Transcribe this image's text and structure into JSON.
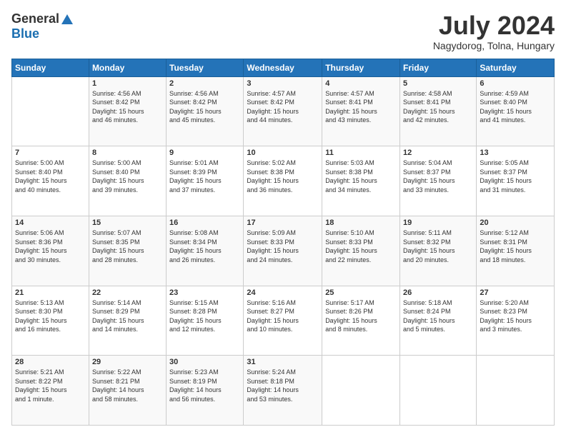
{
  "logo": {
    "general": "General",
    "blue": "Blue"
  },
  "header": {
    "month": "July 2024",
    "location": "Nagydorog, Tolna, Hungary"
  },
  "weekdays": [
    "Sunday",
    "Monday",
    "Tuesday",
    "Wednesday",
    "Thursday",
    "Friday",
    "Saturday"
  ],
  "weeks": [
    [
      {
        "day": "",
        "info": ""
      },
      {
        "day": "1",
        "info": "Sunrise: 4:56 AM\nSunset: 8:42 PM\nDaylight: 15 hours\nand 46 minutes."
      },
      {
        "day": "2",
        "info": "Sunrise: 4:56 AM\nSunset: 8:42 PM\nDaylight: 15 hours\nand 45 minutes."
      },
      {
        "day": "3",
        "info": "Sunrise: 4:57 AM\nSunset: 8:42 PM\nDaylight: 15 hours\nand 44 minutes."
      },
      {
        "day": "4",
        "info": "Sunrise: 4:57 AM\nSunset: 8:41 PM\nDaylight: 15 hours\nand 43 minutes."
      },
      {
        "day": "5",
        "info": "Sunrise: 4:58 AM\nSunset: 8:41 PM\nDaylight: 15 hours\nand 42 minutes."
      },
      {
        "day": "6",
        "info": "Sunrise: 4:59 AM\nSunset: 8:40 PM\nDaylight: 15 hours\nand 41 minutes."
      }
    ],
    [
      {
        "day": "7",
        "info": "Sunrise: 5:00 AM\nSunset: 8:40 PM\nDaylight: 15 hours\nand 40 minutes."
      },
      {
        "day": "8",
        "info": "Sunrise: 5:00 AM\nSunset: 8:40 PM\nDaylight: 15 hours\nand 39 minutes."
      },
      {
        "day": "9",
        "info": "Sunrise: 5:01 AM\nSunset: 8:39 PM\nDaylight: 15 hours\nand 37 minutes."
      },
      {
        "day": "10",
        "info": "Sunrise: 5:02 AM\nSunset: 8:38 PM\nDaylight: 15 hours\nand 36 minutes."
      },
      {
        "day": "11",
        "info": "Sunrise: 5:03 AM\nSunset: 8:38 PM\nDaylight: 15 hours\nand 34 minutes."
      },
      {
        "day": "12",
        "info": "Sunrise: 5:04 AM\nSunset: 8:37 PM\nDaylight: 15 hours\nand 33 minutes."
      },
      {
        "day": "13",
        "info": "Sunrise: 5:05 AM\nSunset: 8:37 PM\nDaylight: 15 hours\nand 31 minutes."
      }
    ],
    [
      {
        "day": "14",
        "info": "Sunrise: 5:06 AM\nSunset: 8:36 PM\nDaylight: 15 hours\nand 30 minutes."
      },
      {
        "day": "15",
        "info": "Sunrise: 5:07 AM\nSunset: 8:35 PM\nDaylight: 15 hours\nand 28 minutes."
      },
      {
        "day": "16",
        "info": "Sunrise: 5:08 AM\nSunset: 8:34 PM\nDaylight: 15 hours\nand 26 minutes."
      },
      {
        "day": "17",
        "info": "Sunrise: 5:09 AM\nSunset: 8:33 PM\nDaylight: 15 hours\nand 24 minutes."
      },
      {
        "day": "18",
        "info": "Sunrise: 5:10 AM\nSunset: 8:33 PM\nDaylight: 15 hours\nand 22 minutes."
      },
      {
        "day": "19",
        "info": "Sunrise: 5:11 AM\nSunset: 8:32 PM\nDaylight: 15 hours\nand 20 minutes."
      },
      {
        "day": "20",
        "info": "Sunrise: 5:12 AM\nSunset: 8:31 PM\nDaylight: 15 hours\nand 18 minutes."
      }
    ],
    [
      {
        "day": "21",
        "info": "Sunrise: 5:13 AM\nSunset: 8:30 PM\nDaylight: 15 hours\nand 16 minutes."
      },
      {
        "day": "22",
        "info": "Sunrise: 5:14 AM\nSunset: 8:29 PM\nDaylight: 15 hours\nand 14 minutes."
      },
      {
        "day": "23",
        "info": "Sunrise: 5:15 AM\nSunset: 8:28 PM\nDaylight: 15 hours\nand 12 minutes."
      },
      {
        "day": "24",
        "info": "Sunrise: 5:16 AM\nSunset: 8:27 PM\nDaylight: 15 hours\nand 10 minutes."
      },
      {
        "day": "25",
        "info": "Sunrise: 5:17 AM\nSunset: 8:26 PM\nDaylight: 15 hours\nand 8 minutes."
      },
      {
        "day": "26",
        "info": "Sunrise: 5:18 AM\nSunset: 8:24 PM\nDaylight: 15 hours\nand 5 minutes."
      },
      {
        "day": "27",
        "info": "Sunrise: 5:20 AM\nSunset: 8:23 PM\nDaylight: 15 hours\nand 3 minutes."
      }
    ],
    [
      {
        "day": "28",
        "info": "Sunrise: 5:21 AM\nSunset: 8:22 PM\nDaylight: 15 hours\nand 1 minute."
      },
      {
        "day": "29",
        "info": "Sunrise: 5:22 AM\nSunset: 8:21 PM\nDaylight: 14 hours\nand 58 minutes."
      },
      {
        "day": "30",
        "info": "Sunrise: 5:23 AM\nSunset: 8:19 PM\nDaylight: 14 hours\nand 56 minutes."
      },
      {
        "day": "31",
        "info": "Sunrise: 5:24 AM\nSunset: 8:18 PM\nDaylight: 14 hours\nand 53 minutes."
      },
      {
        "day": "",
        "info": ""
      },
      {
        "day": "",
        "info": ""
      },
      {
        "day": "",
        "info": ""
      }
    ]
  ]
}
